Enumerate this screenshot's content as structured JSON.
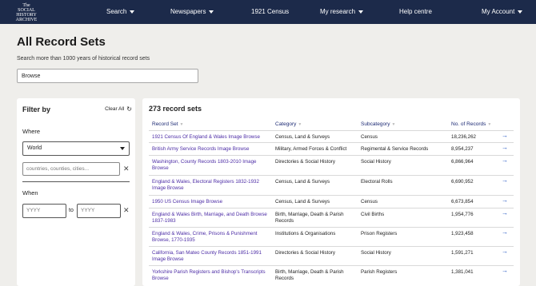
{
  "header": {
    "logo_lines": [
      "The",
      "SOCIAL",
      "HISTORY",
      "ARCHIVE"
    ],
    "nav": [
      {
        "label": "Search",
        "has_dropdown": true
      },
      {
        "label": "Newspapers",
        "has_dropdown": true
      },
      {
        "label": "1921 Census",
        "has_dropdown": false
      },
      {
        "label": "My research",
        "has_dropdown": true
      },
      {
        "label": "Help centre",
        "has_dropdown": false
      },
      {
        "label": "My Account",
        "has_dropdown": true
      }
    ]
  },
  "page": {
    "title": "All Record Sets",
    "subtitle": "Search more than 1000 years of historical record sets",
    "search_value": "Browse"
  },
  "filter": {
    "title": "Filter by",
    "clear_all": "Clear All",
    "where_label": "Where",
    "where_value": "World",
    "place_placeholder": "countries, counties, cities...",
    "when_label": "When",
    "from_placeholder": "YYYY",
    "to_label": "to",
    "to_placeholder": "YYYY"
  },
  "results": {
    "count_label": "273 record sets",
    "columns": [
      "Record Set",
      "Category",
      "Subcategory",
      "No. of Records"
    ],
    "rows": [
      {
        "set": "1921 Census Of England & Wales Image Browse",
        "category": "Census, Land & Surveys",
        "subcategory": "Census",
        "count": "18,236,262"
      },
      {
        "set": "British Army Service Records Image Browse",
        "category": "Military, Armed Forces & Conflict",
        "subcategory": "Regimental & Service Records",
        "count": "8,954,237"
      },
      {
        "set": "Washington, County Records 1803-2010 Image Browse",
        "category": "Directories & Social History",
        "subcategory": "Social History",
        "count": "6,866,964"
      },
      {
        "set": "England & Wales, Electoral Registers 1832-1932 Image Browse",
        "category": "Census, Land & Surveys",
        "subcategory": "Electoral Rolls",
        "count": "6,690,952"
      },
      {
        "set": "1950 US Census Image Browse",
        "category": "Census, Land & Surveys",
        "subcategory": "Census",
        "count": "6,673,854"
      },
      {
        "set": "England & Wales Birth, Marriage, and Death Browse 1837-1983",
        "category": "Birth, Marriage, Death & Parish Records",
        "subcategory": "Civil Births",
        "count": "1,954,776"
      },
      {
        "set": "England & Wales, Crime, Prisons & Punishment Browse, 1770-1935",
        "category": "Institutions & Organisations",
        "subcategory": "Prison Registers",
        "count": "1,923,458"
      },
      {
        "set": "California, San Mateo County Records 1851-1991 Image Browse",
        "category": "Directories & Social History",
        "subcategory": "Social History",
        "count": "1,591,271"
      },
      {
        "set": "Yorkshire Parish Registers and Bishop's Transcripts Browse",
        "category": "Birth, Marriage, Death & Parish Records",
        "subcategory": "Parish Registers",
        "count": "1,381,041"
      }
    ]
  },
  "colors": {
    "header_bg": "#1c2a4a",
    "link": "#4d2da6",
    "arrow": "#1e52c0",
    "page_bg": "#efeeeb"
  },
  "icons": {
    "sort": "sort-arrows-icon",
    "row_link": "arrow-right-icon",
    "clear": "refresh-icon",
    "remove": "close-icon"
  }
}
